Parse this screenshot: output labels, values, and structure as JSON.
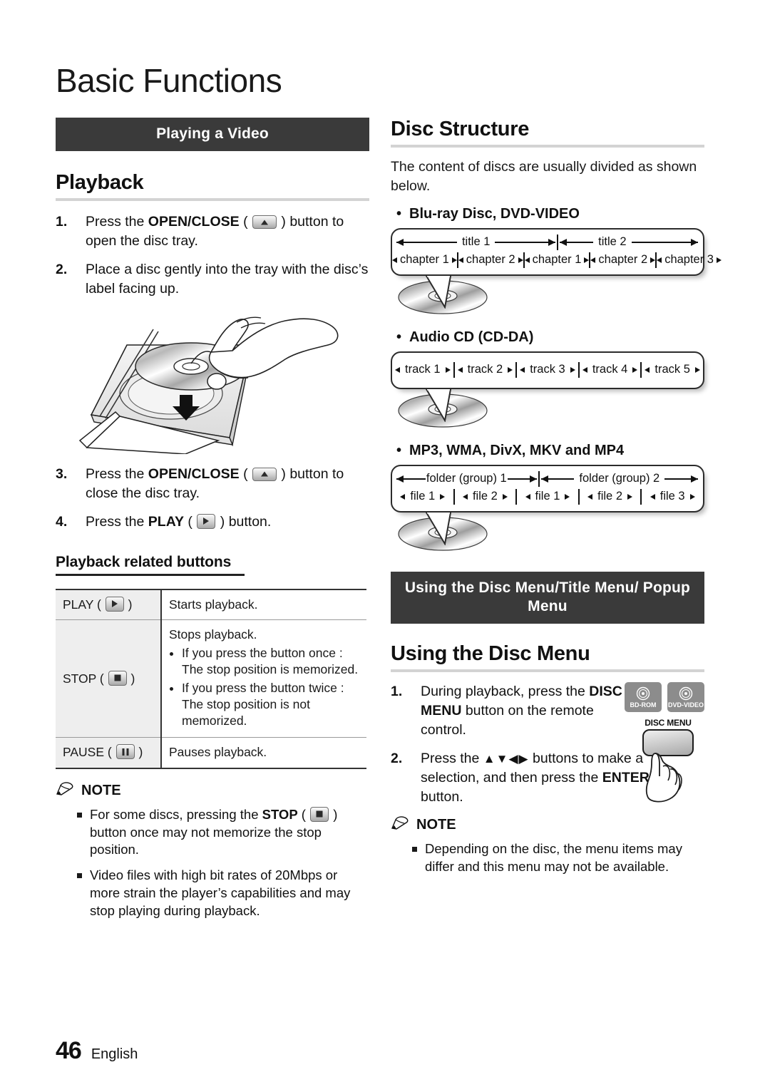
{
  "page": {
    "title": "Basic Functions",
    "footer_number": "46",
    "footer_language": "English"
  },
  "left": {
    "banner": "Playing a Video",
    "playback": {
      "heading": "Playback",
      "steps": [
        {
          "num": "1.",
          "pre": "Press the ",
          "bold": "OPEN/CLOSE",
          "mid": " ( ",
          "icon": "eject-key-icon",
          "post": " ) button to open the disc tray."
        },
        {
          "num": "2.",
          "pre": "Place a disc gently into the tray with the disc’s label facing up.",
          "bold": "",
          "mid": "",
          "icon": "",
          "post": ""
        },
        {
          "num": "3.",
          "pre": "Press the ",
          "bold": "OPEN/CLOSE",
          "mid": " ( ",
          "icon": "eject-key-icon",
          "post": " ) button to close the disc tray."
        },
        {
          "num": "4.",
          "pre": "Press the ",
          "bold": "PLAY",
          "mid": " ( ",
          "icon": "play-key-icon",
          "post": " ) button."
        }
      ],
      "illustration_alt": "hand placing disc into open disc tray"
    },
    "related_buttons": {
      "heading": "Playback related buttons",
      "rows": [
        {
          "key_label": "PLAY",
          "key_icon": "play-key-icon",
          "desc": "Starts playback.",
          "bullets": []
        },
        {
          "key_label": "STOP",
          "key_icon": "stop-key-icon",
          "desc": "Stops playback.",
          "bullets": [
            "If you press the button once : The stop position is memorized.",
            "If you press the button twice : The stop position is not memorized."
          ]
        },
        {
          "key_label": "PAUSE",
          "key_icon": "pause-key-icon",
          "desc": "Pauses playback.",
          "bullets": []
        }
      ]
    },
    "note": {
      "label": "NOTE",
      "items": [
        {
          "pre": "For some discs, pressing the ",
          "bold": "STOP",
          "mid": " ( ",
          "icon": "stop-key-icon",
          "post": " ) button once may not memorize the stop position."
        },
        {
          "pre": "Video files with high bit rates of 20Mbps or more strain the player’s capabilities and may stop playing during playback.",
          "bold": "",
          "mid": "",
          "icon": "",
          "post": ""
        }
      ]
    }
  },
  "right": {
    "disc_structure": {
      "heading": "Disc Structure",
      "intro": "The content of discs are usually divided as shown below.",
      "groups": [
        {
          "label": "Blu-ray Disc, DVD-VIDEO",
          "top_row": [
            "title 1",
            "title 2"
          ],
          "cells": [
            "chapter 1",
            "chapter 2",
            "chapter 1",
            "chapter 2",
            "chapter 3"
          ]
        },
        {
          "label": "Audio CD (CD-DA)",
          "top_row": [],
          "cells": [
            "track 1",
            "track 2",
            "track 3",
            "track 4",
            "track 5"
          ]
        },
        {
          "label": "MP3, WMA, DivX, MKV and MP4",
          "top_row": [
            "folder (group) 1",
            "folder (group) 2"
          ],
          "cells": [
            "file 1",
            "file 2",
            "file 1",
            "file 2",
            "file 3"
          ]
        }
      ]
    },
    "menu_banner": "Using the Disc Menu/Title Menu/ Popup Menu",
    "disc_menu": {
      "heading": "Using the Disc Menu",
      "badges": [
        "BD-ROM",
        "DVD-VIDEO"
      ],
      "remote_key_caption": "DISC MENU",
      "steps": [
        {
          "num": "1.",
          "pre": "During playback, press the ",
          "bold": "DISC MENU",
          "post": " button on the remote control."
        },
        {
          "num": "2.",
          "pre": "Press the ",
          "arrows": "▲▼◀▶",
          "mid": " buttons to make a selection, and then press the ",
          "bold": "ENTER",
          "post": " button."
        }
      ],
      "note": {
        "label": "NOTE",
        "items": [
          "Depending on the disc, the menu items may differ and this menu may not be available."
        ]
      }
    }
  },
  "colors": {
    "banner_bg": "#3a3a3a",
    "rule_gray": "#d3d3d3",
    "table_key_bg": "#eeeeee",
    "badge_gray": "#8c8c8c"
  }
}
